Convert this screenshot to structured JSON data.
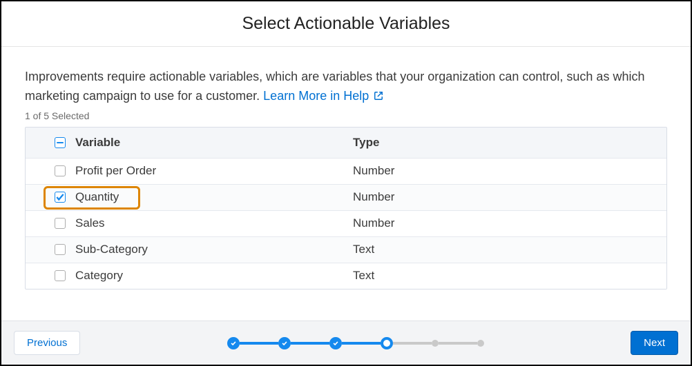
{
  "header": {
    "title": "Select Actionable Variables"
  },
  "description": {
    "text": "Improvements require actionable variables, which are variables that your organization can control, such as which marketing campaign to use for a customer. ",
    "link_label": "Learn More in Help"
  },
  "selection_status": "1 of 5 Selected",
  "table": {
    "columns": {
      "variable": "Variable",
      "type": "Type"
    },
    "header_checkbox_state": "indeterminate",
    "rows": [
      {
        "variable": "Profit per Order",
        "type": "Number",
        "checked": false,
        "highlighted": false
      },
      {
        "variable": "Quantity",
        "type": "Number",
        "checked": true,
        "highlighted": true
      },
      {
        "variable": "Sales",
        "type": "Number",
        "checked": false,
        "highlighted": false
      },
      {
        "variable": "Sub-Category",
        "type": "Text",
        "checked": false,
        "highlighted": false
      },
      {
        "variable": "Category",
        "type": "Text",
        "checked": false,
        "highlighted": false
      }
    ]
  },
  "stepper": {
    "steps": [
      "done",
      "done",
      "done",
      "current",
      "future",
      "future"
    ]
  },
  "footer": {
    "previous": "Previous",
    "next": "Next"
  },
  "colors": {
    "accent": "#0070d2",
    "highlight": "#dd8500"
  }
}
